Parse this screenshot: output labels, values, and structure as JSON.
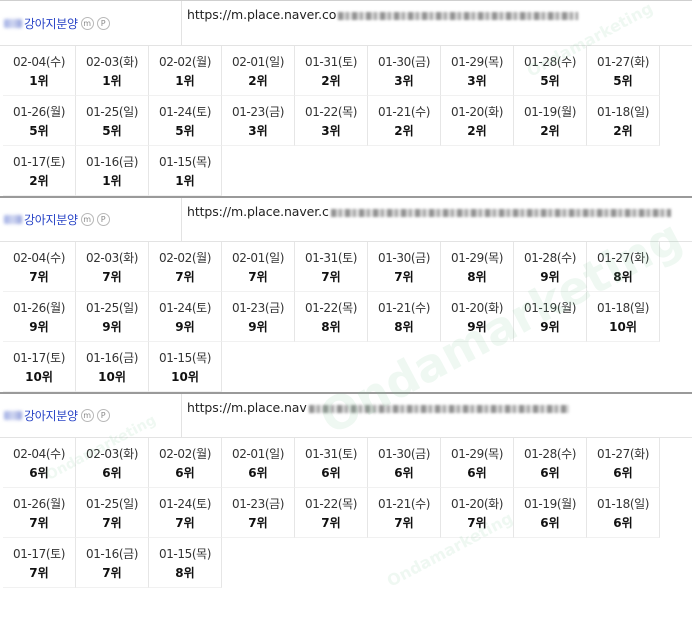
{
  "entries": [
    {
      "place_name": "강아지분양",
      "badge_m": "m",
      "badge_p": "P",
      "url": "https://m.place.naver.co",
      "cells": [
        {
          "date": "02-04(수)",
          "rank": "1위"
        },
        {
          "date": "02-03(화)",
          "rank": "1위"
        },
        {
          "date": "02-02(월)",
          "rank": "1위"
        },
        {
          "date": "02-01(일)",
          "rank": "2위"
        },
        {
          "date": "01-31(토)",
          "rank": "2위"
        },
        {
          "date": "01-30(금)",
          "rank": "3위"
        },
        {
          "date": "01-29(목)",
          "rank": "3위"
        },
        {
          "date": "01-28(수)",
          "rank": "5위"
        },
        {
          "date": "01-27(화)",
          "rank": "5위"
        },
        {
          "date": "01-26(월)",
          "rank": "5위"
        },
        {
          "date": "01-25(일)",
          "rank": "5위"
        },
        {
          "date": "01-24(토)",
          "rank": "5위"
        },
        {
          "date": "01-23(금)",
          "rank": "3위"
        },
        {
          "date": "01-22(목)",
          "rank": "3위"
        },
        {
          "date": "01-21(수)",
          "rank": "2위"
        },
        {
          "date": "01-20(화)",
          "rank": "2위"
        },
        {
          "date": "01-19(월)",
          "rank": "2위"
        },
        {
          "date": "01-18(일)",
          "rank": "2위"
        },
        {
          "date": "01-17(토)",
          "rank": "2위"
        },
        {
          "date": "01-16(금)",
          "rank": "1위"
        },
        {
          "date": "01-15(목)",
          "rank": "1위"
        }
      ]
    },
    {
      "place_name": "강아지분양",
      "badge_m": "m",
      "badge_p": "P",
      "url": "https://m.place.naver.c",
      "cells": [
        {
          "date": "02-04(수)",
          "rank": "7위"
        },
        {
          "date": "02-03(화)",
          "rank": "7위"
        },
        {
          "date": "02-02(월)",
          "rank": "7위"
        },
        {
          "date": "02-01(일)",
          "rank": "7위"
        },
        {
          "date": "01-31(토)",
          "rank": "7위"
        },
        {
          "date": "01-30(금)",
          "rank": "7위"
        },
        {
          "date": "01-29(목)",
          "rank": "8위"
        },
        {
          "date": "01-28(수)",
          "rank": "9위"
        },
        {
          "date": "01-27(화)",
          "rank": "8위"
        },
        {
          "date": "01-26(월)",
          "rank": "9위"
        },
        {
          "date": "01-25(일)",
          "rank": "9위"
        },
        {
          "date": "01-24(토)",
          "rank": "9위"
        },
        {
          "date": "01-23(금)",
          "rank": "9위"
        },
        {
          "date": "01-22(목)",
          "rank": "8위"
        },
        {
          "date": "01-21(수)",
          "rank": "8위"
        },
        {
          "date": "01-20(화)",
          "rank": "9위"
        },
        {
          "date": "01-19(월)",
          "rank": "9위"
        },
        {
          "date": "01-18(일)",
          "rank": "10위"
        },
        {
          "date": "01-17(토)",
          "rank": "10위"
        },
        {
          "date": "01-16(금)",
          "rank": "10위"
        },
        {
          "date": "01-15(목)",
          "rank": "10위"
        }
      ]
    },
    {
      "place_name": "강아지분양",
      "badge_m": "m",
      "badge_p": "P",
      "url": "https://m.place.nav",
      "cells": [
        {
          "date": "02-04(수)",
          "rank": "6위"
        },
        {
          "date": "02-03(화)",
          "rank": "6위"
        },
        {
          "date": "02-02(월)",
          "rank": "6위"
        },
        {
          "date": "02-01(일)",
          "rank": "6위"
        },
        {
          "date": "01-31(토)",
          "rank": "6위"
        },
        {
          "date": "01-30(금)",
          "rank": "6위"
        },
        {
          "date": "01-29(목)",
          "rank": "6위"
        },
        {
          "date": "01-28(수)",
          "rank": "6위"
        },
        {
          "date": "01-27(화)",
          "rank": "6위"
        },
        {
          "date": "01-26(월)",
          "rank": "7위"
        },
        {
          "date": "01-25(일)",
          "rank": "7위"
        },
        {
          "date": "01-24(토)",
          "rank": "7위"
        },
        {
          "date": "01-23(금)",
          "rank": "7위"
        },
        {
          "date": "01-22(목)",
          "rank": "7위"
        },
        {
          "date": "01-21(수)",
          "rank": "7위"
        },
        {
          "date": "01-20(화)",
          "rank": "7위"
        },
        {
          "date": "01-19(월)",
          "rank": "6위"
        },
        {
          "date": "01-18(일)",
          "rank": "6위"
        },
        {
          "date": "01-17(토)",
          "rank": "7위"
        },
        {
          "date": "01-16(금)",
          "rank": "7위"
        },
        {
          "date": "01-15(목)",
          "rank": "8위"
        }
      ]
    }
  ],
  "watermark_text": "Ondamarketing",
  "colors": {
    "place_name": "#2a45c7",
    "watermark": "#78c896"
  }
}
